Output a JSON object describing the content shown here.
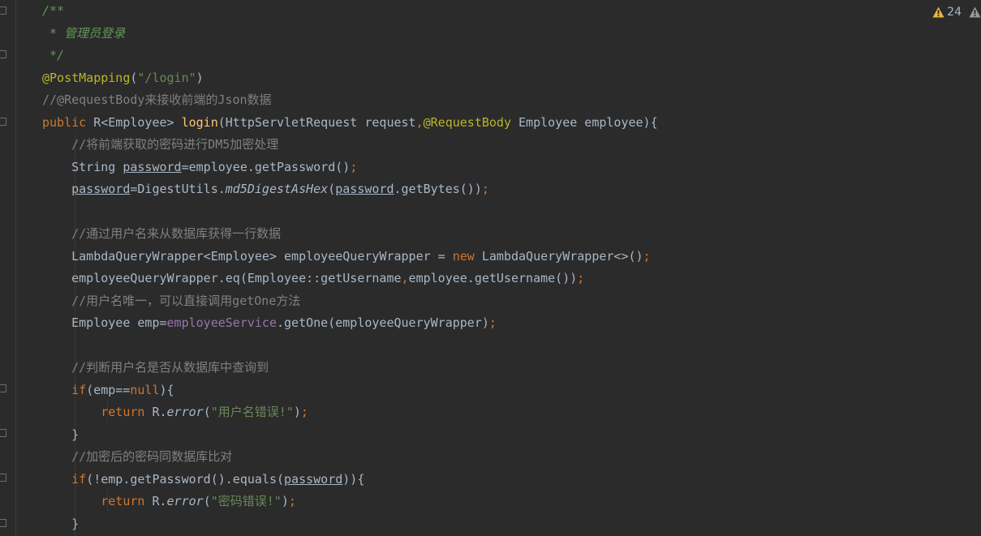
{
  "editor": {
    "warning_count": "24",
    "lines": [
      [
        {
          "t": "/**",
          "c": "doc"
        }
      ],
      [
        {
          "t": " * 管理员登录",
          "c": "doc"
        }
      ],
      [
        {
          "t": " */",
          "c": "doc"
        }
      ],
      [
        {
          "t": "@PostMapping",
          "c": "ann"
        },
        {
          "t": "(",
          "c": ""
        },
        {
          "t": "\"/login\"",
          "c": "str"
        },
        {
          "t": ")",
          "c": ""
        }
      ],
      [
        {
          "t": "//@RequestBody来接收前端的Json数据",
          "c": "cmt"
        }
      ],
      [
        {
          "t": "public ",
          "c": "kw"
        },
        {
          "t": "R<Employee> ",
          "c": ""
        },
        {
          "t": "login",
          "c": "fn"
        },
        {
          "t": "(HttpServletRequest request",
          "c": ""
        },
        {
          "t": ",",
          "c": "kw"
        },
        {
          "t": "@RequestBody ",
          "c": "ann"
        },
        {
          "t": "Employee employee){",
          "c": ""
        }
      ],
      [
        {
          "t": "    //将前端获取的密码进行DM5加密处理",
          "c": "cmt"
        }
      ],
      [
        {
          "t": "    String ",
          "c": ""
        },
        {
          "t": "password",
          "c": "under"
        },
        {
          "t": "=employee.getPassword()",
          "c": ""
        },
        {
          "t": ";",
          "c": "kw"
        }
      ],
      [
        {
          "t": "    ",
          "c": ""
        },
        {
          "t": "password",
          "c": "under"
        },
        {
          "t": "=DigestUtils.",
          "c": ""
        },
        {
          "t": "md5DigestAsHex",
          "c": "ital"
        },
        {
          "t": "(",
          "c": ""
        },
        {
          "t": "password",
          "c": "under"
        },
        {
          "t": ".getBytes())",
          "c": ""
        },
        {
          "t": ";",
          "c": "kw"
        }
      ],
      [],
      [
        {
          "t": "    //通过用户名来从数据库获得一行数据",
          "c": "cmt"
        }
      ],
      [
        {
          "t": "    LambdaQueryWrapper<Employee> employeeQueryWrapper = ",
          "c": ""
        },
        {
          "t": "new ",
          "c": "kw"
        },
        {
          "t": "LambdaQueryWrapper<>()",
          "c": ""
        },
        {
          "t": ";",
          "c": "kw"
        }
      ],
      [
        {
          "t": "    employeeQueryWrapper.eq(Employee::getUsername",
          "c": ""
        },
        {
          "t": ",",
          "c": "kw"
        },
        {
          "t": "employee.getUsername())",
          "c": ""
        },
        {
          "t": ";",
          "c": "kw"
        }
      ],
      [
        {
          "t": "    //用户名唯一，可以直接调用getOne方法",
          "c": "cmt"
        }
      ],
      [
        {
          "t": "    Employee emp=",
          "c": ""
        },
        {
          "t": "employeeService",
          "c": "field"
        },
        {
          "t": ".getOne(employeeQueryWrapper)",
          "c": ""
        },
        {
          "t": ";",
          "c": "kw"
        }
      ],
      [],
      [
        {
          "t": "    //判断用户名是否从数据库中查询到",
          "c": "cmt"
        }
      ],
      [
        {
          "t": "    ",
          "c": ""
        },
        {
          "t": "if",
          "c": "kw"
        },
        {
          "t": "(emp==",
          "c": ""
        },
        {
          "t": "null",
          "c": "kw"
        },
        {
          "t": "){",
          "c": ""
        }
      ],
      [
        {
          "t": "        ",
          "c": ""
        },
        {
          "t": "return ",
          "c": "kw"
        },
        {
          "t": "R.",
          "c": ""
        },
        {
          "t": "error",
          "c": "ital"
        },
        {
          "t": "(",
          "c": ""
        },
        {
          "t": "\"用户名错误!\"",
          "c": "str"
        },
        {
          "t": ")",
          "c": ""
        },
        {
          "t": ";",
          "c": "kw"
        }
      ],
      [
        {
          "t": "    }",
          "c": ""
        }
      ],
      [
        {
          "t": "    //加密后的密码同数据库比对",
          "c": "cmt"
        }
      ],
      [
        {
          "t": "    ",
          "c": ""
        },
        {
          "t": "if",
          "c": "kw"
        },
        {
          "t": "(!emp.getPassword().equals(",
          "c": ""
        },
        {
          "t": "password",
          "c": "under"
        },
        {
          "t": ")){",
          "c": ""
        }
      ],
      [
        {
          "t": "        ",
          "c": ""
        },
        {
          "t": "return ",
          "c": "kw"
        },
        {
          "t": "R.",
          "c": ""
        },
        {
          "t": "error",
          "c": "ital"
        },
        {
          "t": "(",
          "c": ""
        },
        {
          "t": "\"密码错误!\"",
          "c": "str"
        },
        {
          "t": ")",
          "c": ""
        },
        {
          "t": ";",
          "c": "kw"
        }
      ],
      [
        {
          "t": "    }",
          "c": ""
        }
      ]
    ]
  },
  "colors": {
    "background": "#2b2b2b",
    "default_text": "#a9b7c6",
    "keyword": "#cc7832",
    "string": "#6a8759",
    "comment": "#808080",
    "doc_comment": "#629755",
    "annotation": "#bbb529",
    "method": "#ffc66d",
    "field": "#9876aa",
    "warning": "#e8b83a"
  },
  "icons": {
    "warning": "warning-triangle-icon",
    "fold": "fold-marker-icon"
  }
}
